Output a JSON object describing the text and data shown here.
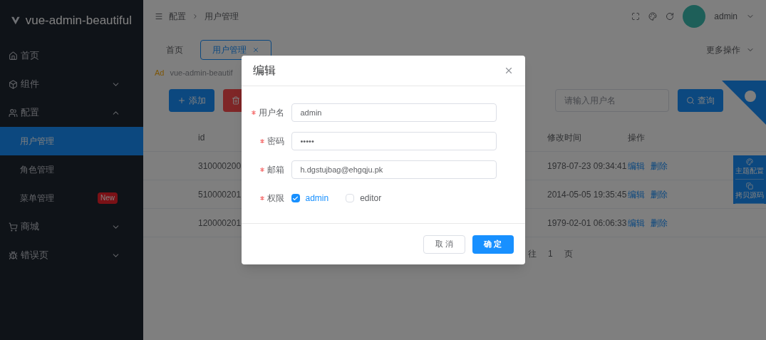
{
  "sidebar": {
    "logo": "vue-admin-beautiful",
    "items": [
      {
        "label": "首页",
        "kind": "link"
      },
      {
        "label": "组件",
        "kind": "submenu",
        "expanded": false
      },
      {
        "label": "配置",
        "kind": "submenu",
        "expanded": true,
        "children": [
          {
            "label": "用户管理",
            "selected": true
          },
          {
            "label": "角色管理",
            "selected": false
          },
          {
            "label": "菜单管理",
            "selected": false,
            "badge": "New"
          }
        ]
      },
      {
        "label": "商城",
        "kind": "submenu",
        "expanded": false
      },
      {
        "label": "错误页",
        "kind": "submenu",
        "expanded": false
      }
    ]
  },
  "header": {
    "breadcrumb": [
      "配置",
      "用户管理"
    ],
    "user": "admin"
  },
  "tabs": [
    {
      "label": "首页",
      "selected": false
    },
    {
      "label": "用户管理",
      "selected": true
    }
  ],
  "more_actions": "更多操作",
  "notice": {
    "badge": "Ad",
    "text": "vue-admin-beautif"
  },
  "toolbar": {
    "add": "添加",
    "search_placeholder": "请输入用户名",
    "search": "查询"
  },
  "table": {
    "columns": [
      "id",
      "修改时间",
      "操作"
    ],
    "rows": [
      {
        "id": "310000200",
        "time": "1978-07-23 09:34:41",
        "actions": [
          "编辑",
          "删除"
        ]
      },
      {
        "id": "510000201",
        "time": "2014-05-05 19:35:45",
        "actions": [
          "编辑",
          "删除"
        ]
      },
      {
        "id": "120000201",
        "time": "1979-02-01 06:06:33",
        "actions": [
          "编辑",
          "删除"
        ]
      }
    ]
  },
  "pagination": {
    "goto": "往",
    "page": "1",
    "unit": "页"
  },
  "side_tabs": [
    "主题配置",
    "拷贝源码"
  ],
  "dialog": {
    "title": "编辑",
    "fields": [
      {
        "label": "用户名",
        "required": true,
        "value": "admin"
      },
      {
        "label": "密码",
        "required": true,
        "value": "•••••"
      },
      {
        "label": "邮箱",
        "required": true,
        "value": "h.dgstujbag@ehgqju.pk"
      }
    ],
    "permissions": {
      "label": "权限",
      "required": true,
      "options": [
        {
          "label": "admin",
          "checked": true
        },
        {
          "label": "editor",
          "checked": false
        }
      ]
    },
    "buttons": {
      "cancel": "取 消",
      "ok": "确 定"
    }
  }
}
